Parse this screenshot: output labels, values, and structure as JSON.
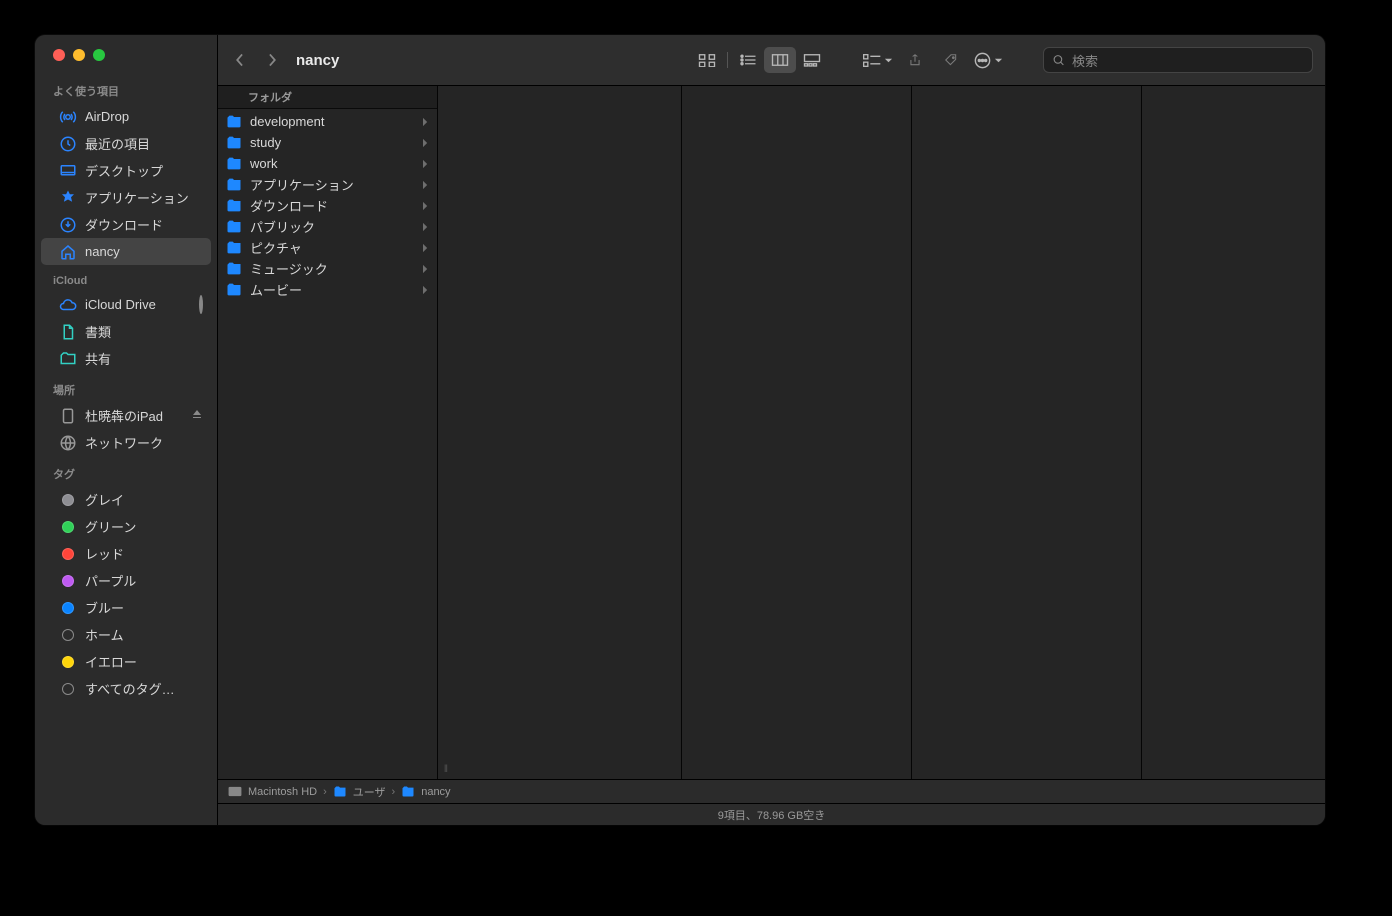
{
  "title": "nancy",
  "search_placeholder": "検索",
  "sidebar": {
    "favorites_head": "よく使う項目",
    "favorites": [
      {
        "label": "AirDrop"
      },
      {
        "label": "最近の項目"
      },
      {
        "label": "デスクトップ"
      },
      {
        "label": "アプリケーション"
      },
      {
        "label": "ダウンロード"
      },
      {
        "label": "nancy"
      }
    ],
    "icloud_head": "iCloud",
    "icloud": [
      {
        "label": "iCloud Drive"
      },
      {
        "label": "書類"
      },
      {
        "label": "共有"
      }
    ],
    "locations_head": "場所",
    "locations": [
      {
        "label": "杜暁犇のiPad"
      },
      {
        "label": "ネットワーク"
      }
    ],
    "tags_head": "タグ",
    "tags": [
      {
        "label": "グレイ",
        "color": "#8e8e93"
      },
      {
        "label": "グリーン",
        "color": "#30d158"
      },
      {
        "label": "レッド",
        "color": "#ff453a"
      },
      {
        "label": "パープル",
        "color": "#bf5af2"
      },
      {
        "label": "ブルー",
        "color": "#0a84ff"
      },
      {
        "label": "ホーム",
        "color": ""
      },
      {
        "label": "イエロー",
        "color": "#ffd60a"
      },
      {
        "label": "すべてのタグ…",
        "color": ""
      }
    ]
  },
  "column_header": "フォルダ",
  "folders": [
    {
      "label": "development"
    },
    {
      "label": "study"
    },
    {
      "label": "work"
    },
    {
      "label": "アプリケーション"
    },
    {
      "label": "ダウンロード"
    },
    {
      "label": "パブリック"
    },
    {
      "label": "ピクチャ"
    },
    {
      "label": "ミュージック"
    },
    {
      "label": "ムービー"
    }
  ],
  "path": [
    {
      "label": "Macintosh HD"
    },
    {
      "label": "ユーザ"
    },
    {
      "label": "nancy"
    }
  ],
  "status": "9項目、78.96 GB空き"
}
